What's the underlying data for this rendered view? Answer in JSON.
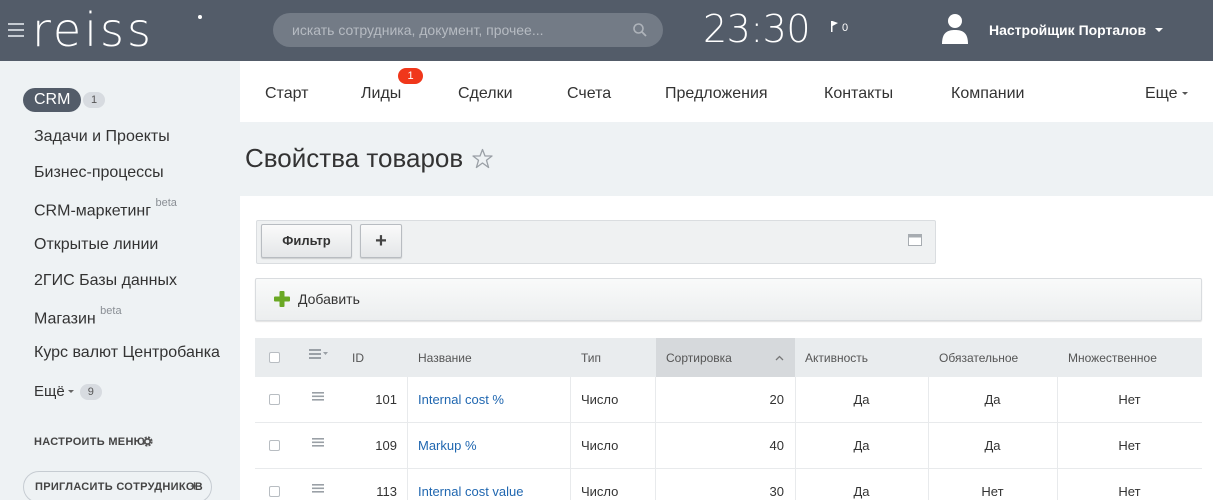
{
  "header": {
    "logo": "reiss",
    "search_placeholder": "искать сотрудника, документ, прочее...",
    "clock": "23:30",
    "notifications_count": "0",
    "user_name": "Настройщик Порталов"
  },
  "sidebar": {
    "crm_label": "CRM",
    "crm_count": "1",
    "items": [
      {
        "label": "Задачи и Проекты",
        "beta": ""
      },
      {
        "label": "Бизнес-процессы",
        "beta": ""
      },
      {
        "label": "CRM-маркетинг",
        "beta": "beta"
      },
      {
        "label": "Открытые линии",
        "beta": ""
      },
      {
        "label": "2ГИС Базы данных",
        "beta": ""
      },
      {
        "label": "Магазин",
        "beta": "beta"
      },
      {
        "label": "Курс валют Центробанка",
        "beta": ""
      }
    ],
    "more_label": "Ещё",
    "more_count": "9",
    "settings_label": "НАСТРОИТЬ МЕНЮ",
    "invite_label": "ПРИГЛАСИТЬ СОТРУДНИКОВ"
  },
  "topmenu": {
    "items": [
      "Старт",
      "Лиды",
      "Сделки",
      "Счета",
      "Предложения",
      "Контакты",
      "Компании"
    ],
    "leads_badge": "1",
    "more_label": "Еще"
  },
  "page": {
    "title": "Свойства товаров"
  },
  "filter": {
    "filter_label": "Фильтр",
    "add_label": "+"
  },
  "toolbar": {
    "add_label": "Добавить"
  },
  "table": {
    "columns": [
      "ID",
      "Название",
      "Тип",
      "Сортировка",
      "Активность",
      "Обязательное",
      "Множественное"
    ],
    "rows": [
      {
        "id": "101",
        "name": "Internal cost %",
        "type": "Число",
        "sort": "20",
        "active": "Да",
        "required": "Да",
        "multiple": "Нет"
      },
      {
        "id": "109",
        "name": "Markup %",
        "type": "Число",
        "sort": "40",
        "active": "Да",
        "required": "Да",
        "multiple": "Нет"
      },
      {
        "id": "113",
        "name": "Internal cost value",
        "type": "Число",
        "sort": "30",
        "active": "Да",
        "required": "Нет",
        "multiple": "Нет"
      }
    ]
  },
  "colors": {
    "header_bg": "#535c69",
    "link": "#2067b0",
    "badge": "#f0371b",
    "page_bg": "#eef2f4"
  },
  "icons": [
    "menu-icon",
    "search-icon",
    "flag-icon",
    "user-avatar-icon",
    "gear-icon",
    "star-icon",
    "window-icon",
    "plus-icon",
    "row-menu-icon",
    "sort-arrow-icon"
  ]
}
